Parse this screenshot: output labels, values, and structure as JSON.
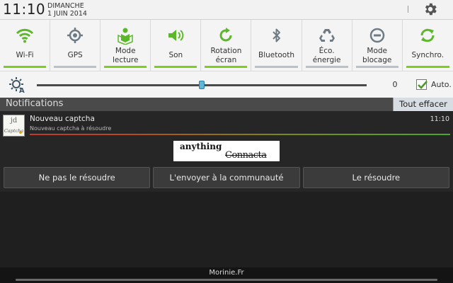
{
  "status": {
    "time": "11:10",
    "day": "DIMANCHE",
    "date": "1 JUIN 2014"
  },
  "toggles": [
    {
      "label": "Wi-Fi",
      "icon": "wifi-icon",
      "active": true
    },
    {
      "label": "GPS",
      "icon": "gps-icon",
      "active": false
    },
    {
      "label": "Mode\nlecture",
      "icon": "reading-mode-icon",
      "active": true
    },
    {
      "label": "Son",
      "icon": "sound-icon",
      "active": true
    },
    {
      "label": "Rotation\nécran",
      "icon": "rotation-icon",
      "active": true
    },
    {
      "label": "Bluetooth",
      "icon": "bluetooth-icon",
      "active": false
    },
    {
      "label": "Éco.\nénergie",
      "icon": "recycle-icon",
      "active": false
    },
    {
      "label": "Mode\nblocage",
      "icon": "block-icon",
      "active": false
    },
    {
      "label": "Synchro.",
      "icon": "sync-icon",
      "active": true
    }
  ],
  "brightness": {
    "value": "0",
    "level_fraction": 0.5,
    "auto_label": "Auto.",
    "auto_checked": true
  },
  "notifications": {
    "title": "Notifications",
    "clear_label": "Tout effacer"
  },
  "card": {
    "app_icon_top": "jd",
    "app_icon_bottom": "Captcha",
    "title": "Nouveau captcha",
    "text": "Nouveau captcha à résoudre",
    "time": "11:10",
    "captcha_word1": "anything",
    "captcha_word2": "Connacta",
    "actions": [
      "Ne pas le résoudre",
      "L'envoyer à la communauté",
      "Le résoudre"
    ]
  },
  "footer": {
    "carrier": "Morinie.Fr"
  },
  "colors": {
    "active_green": "#7ccf1c",
    "inactive_gray": "#b8c2c8",
    "icon_green": "#5cb82a",
    "icon_gray": "#6e7b84"
  }
}
